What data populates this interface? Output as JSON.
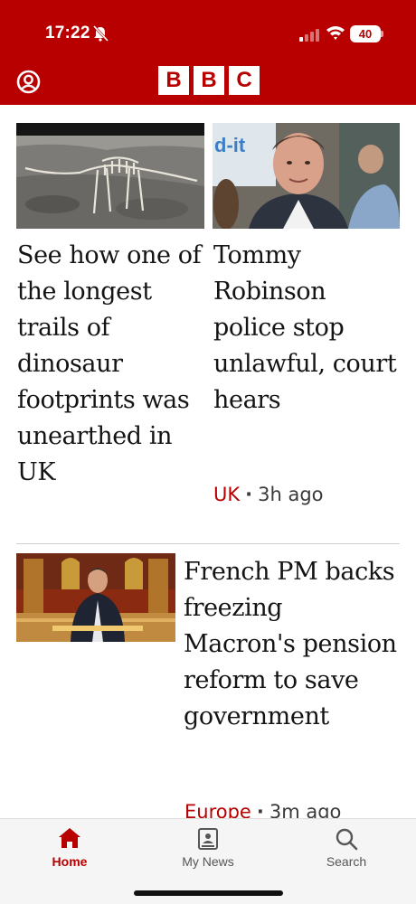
{
  "status_bar": {
    "time": "17:22",
    "battery": "40"
  },
  "header": {
    "logo_letters": [
      "B",
      "B",
      "C"
    ],
    "brand_color": "#b80000"
  },
  "articles": [
    {
      "headline": "See how one of the longest trails of dinosaur footprints was unearthed in UK",
      "image": "dinosaur-skeleton-photo"
    },
    {
      "headline": "Tommy Robinson police stop unlawful, court hears",
      "tag": "UK",
      "time": "3h ago",
      "image": "tommy-robinson-photo"
    },
    {
      "headline": "French PM backs freezing Macron's pension reform to save government",
      "tag": "Europe",
      "time": "3m ago",
      "image": "french-pm-parliament-photo"
    }
  ],
  "bottom_nav": {
    "items": [
      {
        "label": "Home",
        "icon": "home-icon",
        "active": true
      },
      {
        "label": "My News",
        "icon": "my-news-icon",
        "active": false
      },
      {
        "label": "Search",
        "icon": "search-icon",
        "active": false
      }
    ]
  }
}
